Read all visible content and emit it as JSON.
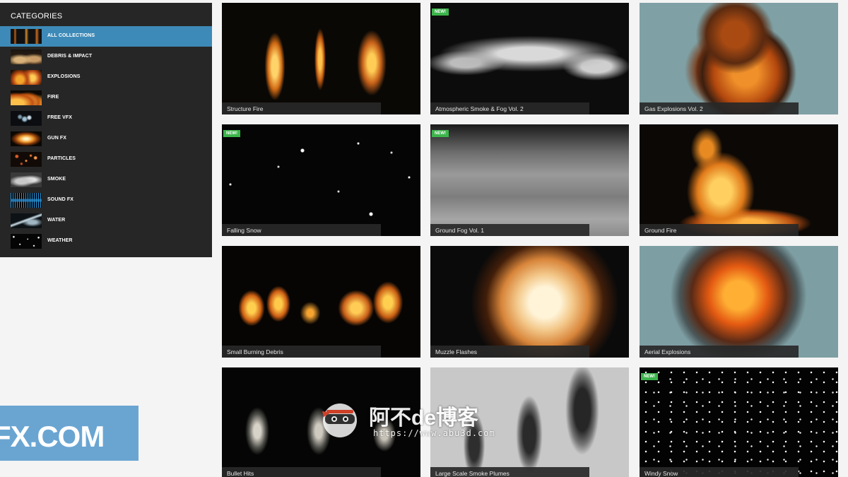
{
  "sidebar": {
    "title": "CATEGORIES",
    "items": [
      {
        "label": "ALL COLLECTIONS",
        "icon": "all-collections-thumbnail",
        "active": true
      },
      {
        "label": "DEBRIS & IMPACT",
        "icon": "debris-impact-thumbnail",
        "active": false
      },
      {
        "label": "EXPLOSIONS",
        "icon": "explosions-thumbnail",
        "active": false
      },
      {
        "label": "FIRE",
        "icon": "fire-thumbnail",
        "active": false
      },
      {
        "label": "FREE VFX",
        "icon": "free-vfx-thumbnail",
        "active": false
      },
      {
        "label": "GUN FX",
        "icon": "gun-fx-thumbnail",
        "active": false
      },
      {
        "label": "PARTICLES",
        "icon": "particles-thumbnail",
        "active": false
      },
      {
        "label": "SMOKE",
        "icon": "smoke-thumbnail",
        "active": false
      },
      {
        "label": "SOUND FX",
        "icon": "sound-fx-thumbnail",
        "active": false
      },
      {
        "label": "WATER",
        "icon": "water-thumbnail",
        "active": false
      },
      {
        "label": "WEATHER",
        "icon": "weather-thumbnail",
        "active": false
      }
    ]
  },
  "collections": [
    {
      "title": "Structure Fire",
      "new": false
    },
    {
      "title": "Atmospheric Smoke & Fog Vol. 2",
      "new": true
    },
    {
      "title": "Gas Explosions Vol. 2",
      "new": false
    },
    {
      "title": "Falling Snow",
      "new": true
    },
    {
      "title": "Ground Fog Vol. 1",
      "new": true
    },
    {
      "title": "Ground Fire",
      "new": false
    },
    {
      "title": "Small Burning Debris",
      "new": false
    },
    {
      "title": "Muzzle Flashes",
      "new": false
    },
    {
      "title": "Aerial Explosions",
      "new": false
    },
    {
      "title": "Bullet Hits",
      "new": false
    },
    {
      "title": "Large Scale Smoke Plumes",
      "new": false
    },
    {
      "title": "Windy Snow",
      "new": true
    }
  ],
  "badge": {
    "new_label": "NEW!"
  },
  "watermark": {
    "logo_text": "FX.COM",
    "blog_title": "阿不de博客",
    "blog_url": "https://www.abu3d.com"
  },
  "colors": {
    "sidebar_bg": "#262626",
    "active_item": "#3d8ab8",
    "new_badge": "#3cb44b",
    "page_bg": "#f4f4f4",
    "watermark_blue": "#5f9fd0"
  }
}
